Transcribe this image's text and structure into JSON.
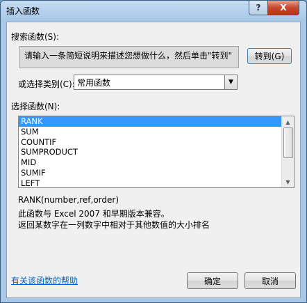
{
  "dialog": {
    "title": "插入函数",
    "help_glyph": "?",
    "close_glyph": "X"
  },
  "search": {
    "label": "搜索函数(S):",
    "value": "请输入一条简短说明来描述您想做什么，然后单击\"转到\"",
    "goto_label": "转到(G)"
  },
  "category": {
    "label": "或选择类别(C):",
    "selected": "常用函数"
  },
  "functions": {
    "label": "选择函数(N):",
    "items": [
      "RANK",
      "SUM",
      "COUNTIF",
      "SUMPRODUCT",
      "MID",
      "SUMIF",
      "LEFT"
    ],
    "selected_index": 0
  },
  "description": {
    "signature": "RANK(number,ref,order)",
    "compat": "此函数与 Excel 2007 和早期版本兼容。",
    "text": "返回某数字在一列数字中相对于其他数值的大小排名"
  },
  "footer": {
    "help_link": "有关该函数的帮助",
    "ok_label": "确定",
    "cancel_label": "取消"
  }
}
